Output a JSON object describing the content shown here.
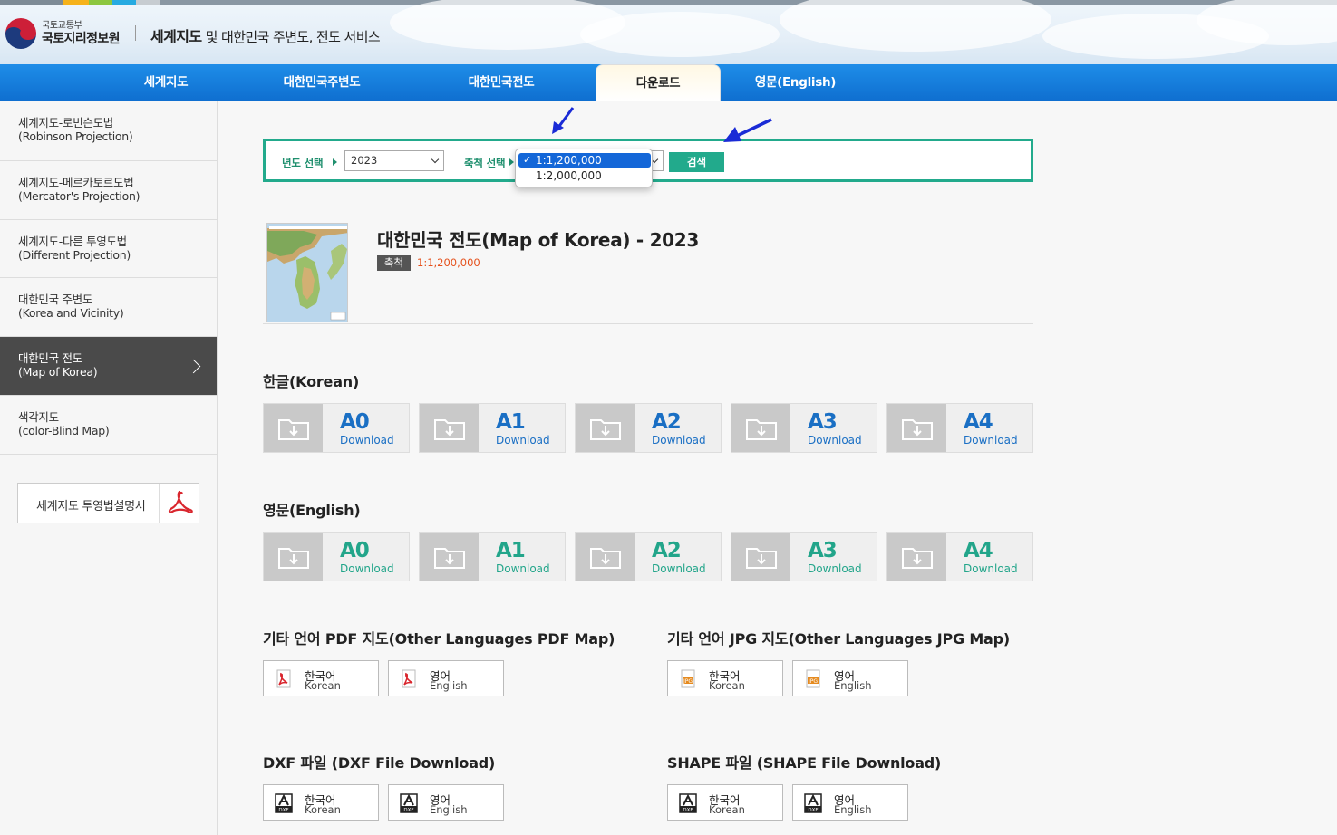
{
  "header": {
    "ministry": "국토교통부",
    "org": "국토지리정보원",
    "service_prefix": "세계지도",
    "service_rest": " 및 대한민국 주변도, 전도 서비스"
  },
  "nav": {
    "items": [
      {
        "label": "세계지도"
      },
      {
        "label": "대한민국주변도"
      },
      {
        "label": "대한민국전도"
      },
      {
        "label": "다운로드"
      },
      {
        "label": "영문(English)"
      }
    ],
    "active": "다운로드"
  },
  "sidebar": {
    "items": [
      {
        "ko": "세계지도-로빈슨도법",
        "en": "(Robinson Projection)"
      },
      {
        "ko": "세계지도-메르카토르도법",
        "en": "(Mercator's Projection)"
      },
      {
        "ko": "세계지도-다른 투영도법",
        "en": "(Different Projection)"
      },
      {
        "ko": "대한민국 주변도",
        "en": "(Korea and Vicinity)"
      },
      {
        "ko": "대한민국 전도",
        "en": "(Map of Korea)"
      },
      {
        "ko": "색각지도",
        "en": "(color-Blind Map)"
      }
    ],
    "active_index": 4,
    "guide_label": "세계지도 투영법설명서"
  },
  "search": {
    "year_label": "년도 선택",
    "year_value": "2023",
    "scale_label": "축척 선택",
    "button_label": "검색",
    "scale_options": [
      "1:1,200,000",
      "1:2,000,000"
    ],
    "selected_scale": "1:1,200,000",
    "check_mark": "✓"
  },
  "map": {
    "title": "대한민국 전도(Map of Korea) - 2023",
    "scale_badge": "축척",
    "scale_value": "1:1,200,000"
  },
  "korean_section": {
    "title": "한글(Korean)",
    "tiles": [
      {
        "size": "A0",
        "label": "Download"
      },
      {
        "size": "A1",
        "label": "Download"
      },
      {
        "size": "A2",
        "label": "Download"
      },
      {
        "size": "A3",
        "label": "Download"
      },
      {
        "size": "A4",
        "label": "Download"
      }
    ]
  },
  "english_section": {
    "title": "영문(English)",
    "tiles": [
      {
        "size": "A0",
        "label": "Download"
      },
      {
        "size": "A1",
        "label": "Download"
      },
      {
        "size": "A2",
        "label": "Download"
      },
      {
        "size": "A3",
        "label": "Download"
      },
      {
        "size": "A4",
        "label": "Download"
      }
    ]
  },
  "pdf_section": {
    "title": "기타 언어 PDF 지도(Other Languages PDF Map)",
    "buttons": [
      {
        "ko": "한국어",
        "en": "Korean"
      },
      {
        "ko": "영어",
        "en": "English"
      }
    ]
  },
  "jpg_section": {
    "title": "기타 언어 JPG 지도(Other Languages JPG Map)",
    "buttons": [
      {
        "ko": "한국어",
        "en": "Korean"
      },
      {
        "ko": "영어",
        "en": "English"
      }
    ]
  },
  "dxf_section": {
    "title": "DXF 파일 (DXF File Download)",
    "buttons": [
      {
        "ko": "한국어",
        "en": "Korean"
      },
      {
        "ko": "영어",
        "en": "English"
      }
    ]
  },
  "shape_section": {
    "title": "SHAPE 파일 (SHAPE File Download)",
    "buttons": [
      {
        "ko": "한국어",
        "en": "Korean"
      },
      {
        "ko": "영어",
        "en": "English"
      }
    ]
  },
  "colors": {
    "nav_blue": "#1479dc",
    "accent_green": "#22aa8c",
    "tile_blue": "#1a6fc4",
    "tile_green": "#22a58a",
    "scale_orange": "#e5501b"
  }
}
